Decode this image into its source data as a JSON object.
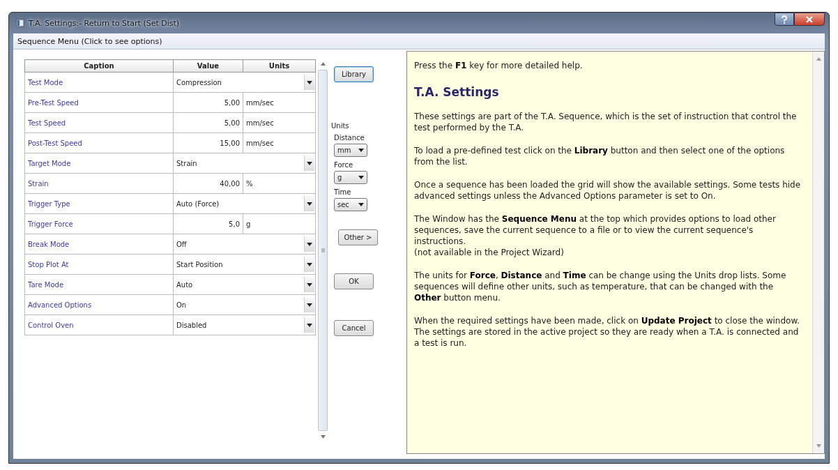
{
  "window": {
    "title": "T.A. Settings:- Return to Start (Set Dist)"
  },
  "menu": {
    "label": "Sequence Menu (Click to see options)"
  },
  "grid": {
    "columns": [
      "Caption",
      "Value",
      "Units"
    ],
    "rows": [
      {
        "kind": "dropdown",
        "caption": "Test Mode",
        "value": "Compression"
      },
      {
        "kind": "number",
        "caption": "Pre-Test Speed",
        "value": "5,00",
        "units": "mm/sec"
      },
      {
        "kind": "number",
        "caption": "Test Speed",
        "value": "5,00",
        "units": "mm/sec"
      },
      {
        "kind": "number",
        "caption": "Post-Test Speed",
        "value": "15,00",
        "units": "mm/sec"
      },
      {
        "kind": "dropdown",
        "caption": "Target Mode",
        "value": "Strain"
      },
      {
        "kind": "number",
        "caption": "Strain",
        "value": "40,00",
        "units": "%"
      },
      {
        "kind": "dropdown",
        "caption": "Trigger Type",
        "value": "Auto (Force)"
      },
      {
        "kind": "number",
        "caption": "Trigger Force",
        "value": "5,0",
        "units": "g"
      },
      {
        "kind": "dropdown",
        "caption": "Break Mode",
        "value": "Off"
      },
      {
        "kind": "dropdown",
        "caption": "Stop Plot At",
        "value": "Start Position"
      },
      {
        "kind": "dropdown",
        "caption": "Tare Mode",
        "value": "Auto"
      },
      {
        "kind": "dropdown",
        "caption": "Advanced Options",
        "value": "On"
      },
      {
        "kind": "dropdown",
        "caption": "Control Oven",
        "value": "Disabled"
      }
    ]
  },
  "library_button": "Library",
  "units": {
    "label": "Units",
    "fields": [
      {
        "label": "Distance",
        "value": "mm"
      },
      {
        "label": "Force",
        "value": "g"
      },
      {
        "label": "Time",
        "value": "sec"
      }
    ]
  },
  "other_button": "Other >",
  "buttons": [
    "OK",
    "Cancel"
  ],
  "help": {
    "intro": "Press the **F1** key for more detailed help.",
    "heading": "T.A. Settings",
    "paragraphs": [
      {
        "text": "These settings are part of the T.A. Sequence, which is the set of instruction that control the test performed by the T.A."
      },
      {
        "text": "To load a pre-defined test click on the **Library** button and then select one of the options from the list."
      },
      {
        "text": "Once a sequence has been loaded the grid will show the available settings. Some tests hide advanced settings unless the Advanced Options parameter is set to On."
      },
      {
        "text": "The Window has the **Sequence Menu** at the top which provides options to load other sequences, save the current sequence to a file or to view the current sequence's instructions.",
        "note": "(not available in the Project Wizard)"
      },
      {
        "text": "The units for **Force**, **Distance** and **Time** can be change using the Units drop lists. Some sequences will define other units, such as temperature, that can be changed with the **Other** button menu."
      },
      {
        "text": "When the required settings have been made, click on **Update Project** to close the window. The settings are stored in the active project so they are ready when a T.A. is connected and a test is run."
      }
    ]
  }
}
